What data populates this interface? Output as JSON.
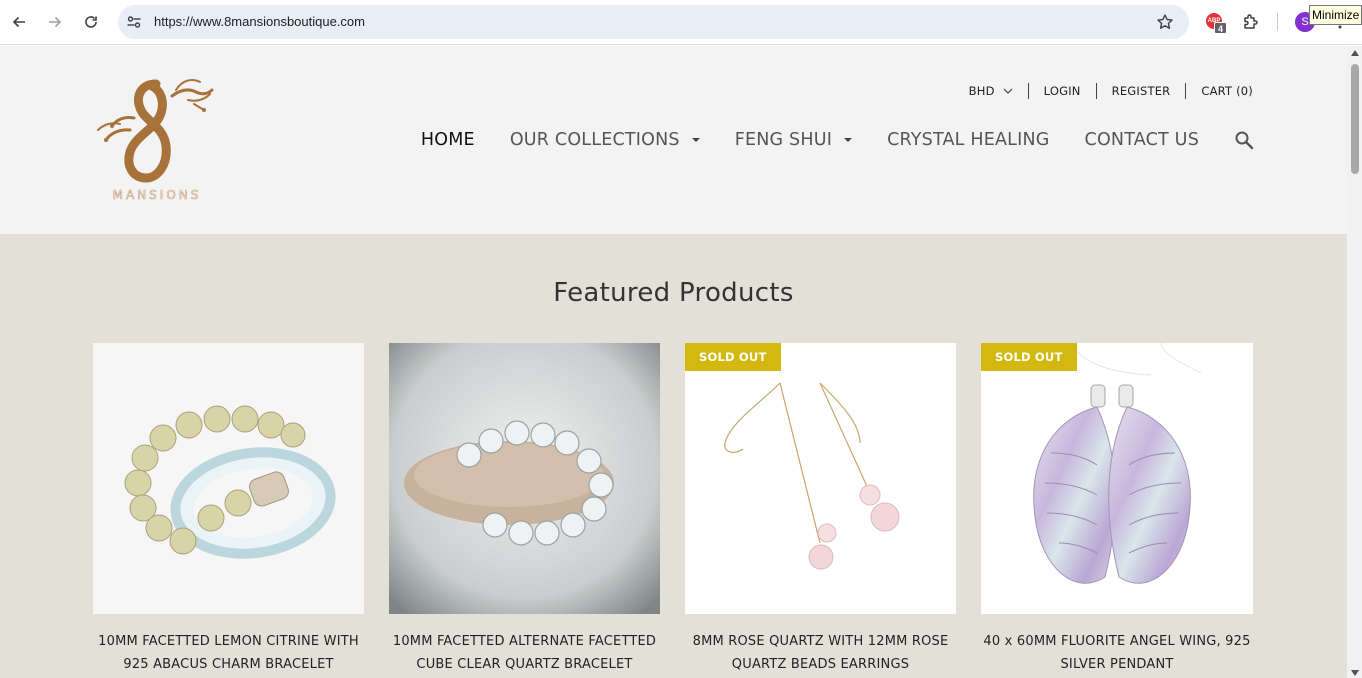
{
  "browser": {
    "url": "https://www.8mansionsboutique.com",
    "extension_badge_count": "4",
    "profile_initial": "S",
    "tooltip": "Minimize",
    "abp_label": "ABP"
  },
  "header": {
    "logo_text": "MANSIONS",
    "topbar": {
      "currency": "BHD",
      "login": "LOGIN",
      "register": "REGISTER",
      "cart": "CART (0)"
    },
    "nav": [
      {
        "label": "HOME",
        "active": true,
        "dropdown": false
      },
      {
        "label": "OUR COLLECTIONS",
        "active": false,
        "dropdown": true
      },
      {
        "label": "FENG SHUI",
        "active": false,
        "dropdown": true
      },
      {
        "label": "CRYSTAL HEALING",
        "active": false,
        "dropdown": false
      },
      {
        "label": "CONTACT US",
        "active": false,
        "dropdown": false
      }
    ]
  },
  "featured": {
    "heading": "Featured Products",
    "products": [
      {
        "title": "10MM FACETTED LEMON CITRINE WITH 925 ABACUS CHARM BRACELET",
        "badge": ""
      },
      {
        "title": "10MM FACETTED ALTERNATE FACETTED CUBE CLEAR QUARTZ BRACELET",
        "badge": ""
      },
      {
        "title": "8MM ROSE QUARTZ WITH 12MM ROSE QUARTZ BEADS EARRINGS",
        "badge": "SOLD OUT"
      },
      {
        "title": "40 x 60MM FLUORITE ANGEL WING, 925 SILVER PENDANT",
        "badge": "SOLD OUT"
      }
    ]
  },
  "colors": {
    "header_bg": "#f3f3f3",
    "featured_bg": "#e3e1d7",
    "badge": "#d4b80f",
    "logo": "#a8723b"
  }
}
